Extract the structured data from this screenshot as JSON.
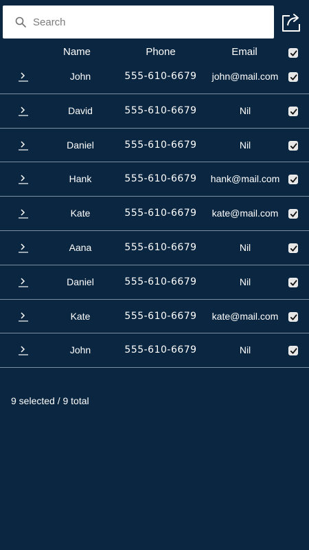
{
  "search": {
    "placeholder": "Search",
    "value": ""
  },
  "columns": {
    "name": "Name",
    "phone": "Phone",
    "email": "Email"
  },
  "rows": [
    {
      "name": "John",
      "phone": "555-610-6679",
      "email": "john@mail.com",
      "checked": true
    },
    {
      "name": "David",
      "phone": "555-610-6679",
      "email": "Nil",
      "checked": true
    },
    {
      "name": "Daniel",
      "phone": "555-610-6679",
      "email": "Nil",
      "checked": true
    },
    {
      "name": "Hank",
      "phone": "555-610-6679",
      "email": "hank@mail.com",
      "checked": true
    },
    {
      "name": "Kate",
      "phone": "555-610-6679",
      "email": "kate@mail.com",
      "checked": true
    },
    {
      "name": "Aana",
      "phone": "555-610-6679",
      "email": "Nil",
      "checked": true
    },
    {
      "name": "Daniel",
      "phone": "555-610-6679",
      "email": "Nil",
      "checked": true
    },
    {
      "name": "Kate",
      "phone": "555-610-6679",
      "email": "kate@mail.com",
      "checked": true
    },
    {
      "name": "John",
      "phone": "555-610-6679",
      "email": "Nil",
      "checked": true
    }
  ],
  "footer": {
    "selection_summary": "9 selected / 9 total"
  },
  "icons": {
    "search": "search-icon",
    "share": "share-icon",
    "row_expand": "chevron-right-icon",
    "check": "check-icon"
  },
  "colors": {
    "background": "#0b2640",
    "text": "#ffffff",
    "divider": "#7c8fa3",
    "search_background": "#ffffff",
    "checkbox_fill": "#e6e6e6"
  }
}
